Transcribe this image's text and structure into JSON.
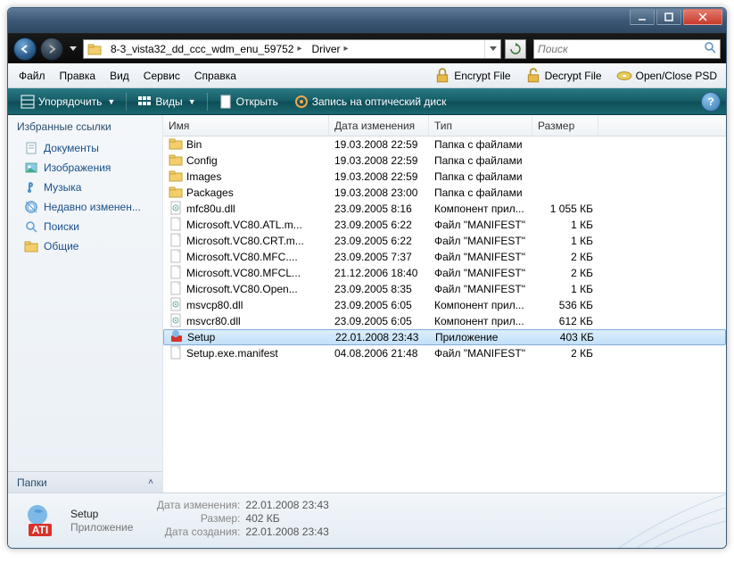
{
  "breadcrumbs": [
    "8-3_vista32_dd_ccc_wdm_enu_59752",
    "Driver"
  ],
  "search_placeholder": "Поиск",
  "menu": [
    "Файл",
    "Правка",
    "Вид",
    "Сервис",
    "Справка"
  ],
  "menubar_actions": [
    {
      "label": "Encrypt File"
    },
    {
      "label": "Decrypt File"
    },
    {
      "label": "Open/Close PSD"
    }
  ],
  "toolbar": {
    "organize": "Упорядочить",
    "views": "Виды",
    "open": "Открыть",
    "burn": "Запись на оптический диск"
  },
  "sidebar": {
    "header": "Избранные ссылки",
    "items": [
      "Документы",
      "Изображения",
      "Музыка",
      "Недавно изменен...",
      "Поиски",
      "Общие"
    ],
    "folders": "Папки"
  },
  "columns": {
    "name": "Имя",
    "date": "Дата изменения",
    "type": "Тип",
    "size": "Размер"
  },
  "files": [
    {
      "icon": "folder",
      "name": "Bin",
      "date": "19.03.2008 22:59",
      "type": "Папка с файлами",
      "size": ""
    },
    {
      "icon": "folder",
      "name": "Config",
      "date": "19.03.2008 22:59",
      "type": "Папка с файлами",
      "size": ""
    },
    {
      "icon": "folder",
      "name": "Images",
      "date": "19.03.2008 22:59",
      "type": "Папка с файлами",
      "size": ""
    },
    {
      "icon": "folder",
      "name": "Packages",
      "date": "19.03.2008 23:00",
      "type": "Папка с файлами",
      "size": ""
    },
    {
      "icon": "dll",
      "name": "mfc80u.dll",
      "date": "23.09.2005 8:16",
      "type": "Компонент прил...",
      "size": "1 055 КБ"
    },
    {
      "icon": "file",
      "name": "Microsoft.VC80.ATL.m...",
      "date": "23.09.2005 6:22",
      "type": "Файл \"MANIFEST\"",
      "size": "1 КБ"
    },
    {
      "icon": "file",
      "name": "Microsoft.VC80.CRT.m...",
      "date": "23.09.2005 6:22",
      "type": "Файл \"MANIFEST\"",
      "size": "1 КБ"
    },
    {
      "icon": "file",
      "name": "Microsoft.VC80.MFC....",
      "date": "23.09.2005 7:37",
      "type": "Файл \"MANIFEST\"",
      "size": "2 КБ"
    },
    {
      "icon": "file",
      "name": "Microsoft.VC80.MFCL...",
      "date": "21.12.2006 18:40",
      "type": "Файл \"MANIFEST\"",
      "size": "2 КБ"
    },
    {
      "icon": "file",
      "name": "Microsoft.VC80.Open...",
      "date": "23.09.2005 8:35",
      "type": "Файл \"MANIFEST\"",
      "size": "1 КБ"
    },
    {
      "icon": "dll",
      "name": "msvcp80.dll",
      "date": "23.09.2005 6:05",
      "type": "Компонент прил...",
      "size": "536 КБ"
    },
    {
      "icon": "dll",
      "name": "msvcr80.dll",
      "date": "23.09.2005 6:05",
      "type": "Компонент прил...",
      "size": "612 КБ"
    },
    {
      "icon": "exe",
      "name": "Setup",
      "date": "22.01.2008 23:43",
      "type": "Приложение",
      "size": "403 КБ",
      "selected": true
    },
    {
      "icon": "file",
      "name": "Setup.exe.manifest",
      "date": "04.08.2006 21:48",
      "type": "Файл \"MANIFEST\"",
      "size": "2 КБ"
    }
  ],
  "details": {
    "name": "Setup",
    "type": "Приложение",
    "labels": {
      "modified": "Дата изменения:",
      "size": "Размер:",
      "created": "Дата создания:"
    },
    "modified": "22.01.2008 23:43",
    "size": "402 КБ",
    "created": "22.01.2008 23:43"
  }
}
